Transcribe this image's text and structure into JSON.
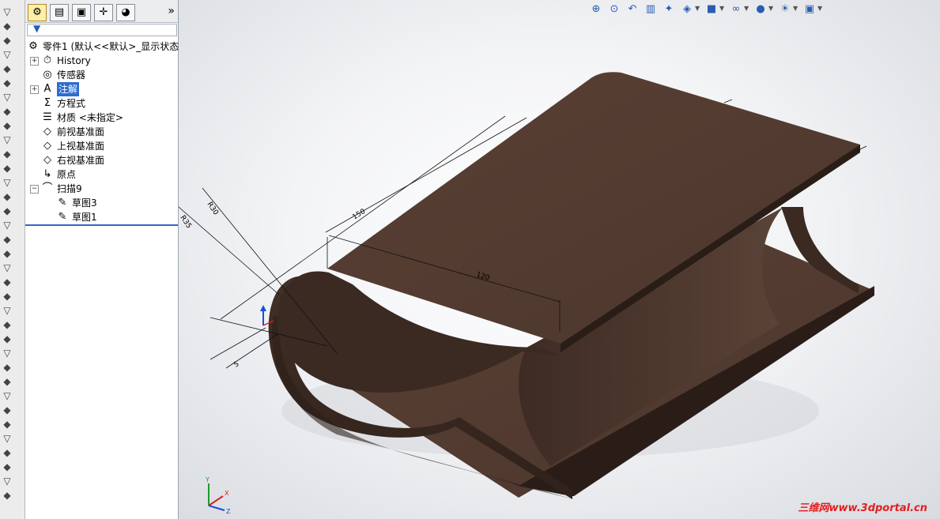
{
  "feature_manager": {
    "tabs": [
      "featuremanager-tab",
      "propertymanager-tab",
      "configurationmanager-tab",
      "dimxpert-tab",
      "display-manager-tab"
    ],
    "more": "»",
    "tree": [
      {
        "label": "零件1  (默认<<默认>_显示状态",
        "icon": "part-icon",
        "level": 0,
        "expander": ""
      },
      {
        "label": "History",
        "icon": "history-icon",
        "level": 1,
        "expander": "+"
      },
      {
        "label": "传感器",
        "icon": "sensor-icon",
        "level": 1,
        "expander": ""
      },
      {
        "label": "注解",
        "icon": "annotation-icon",
        "level": 1,
        "expander": "+",
        "selected": true
      },
      {
        "label": "方程式",
        "icon": "equation-icon",
        "level": 1,
        "expander": ""
      },
      {
        "label": "材质 <未指定>",
        "icon": "material-icon",
        "level": 1,
        "expander": ""
      },
      {
        "label": "前视基准面",
        "icon": "plane-icon",
        "level": 1,
        "expander": ""
      },
      {
        "label": "上视基准面",
        "icon": "plane-icon",
        "level": 1,
        "expander": ""
      },
      {
        "label": "右视基准面",
        "icon": "plane-icon",
        "level": 1,
        "expander": ""
      },
      {
        "label": "原点",
        "icon": "origin-icon",
        "level": 1,
        "expander": ""
      },
      {
        "label": "扫描9",
        "icon": "sweep-icon",
        "level": 1,
        "expander": "−"
      },
      {
        "label": "草图3",
        "icon": "sketch-icon",
        "level": 2,
        "expander": ""
      },
      {
        "label": "草图1",
        "icon": "sketch-icon",
        "level": 2,
        "expander": ""
      }
    ]
  },
  "heads_up_toolbar": [
    "zoom-to-fit-icon",
    "zoom-to-area-icon",
    "previous-view-icon",
    "section-view-icon",
    "dynamic-annotation-icon",
    "view-orientation-icon",
    "display-style-icon",
    "hide-show-items-icon",
    "edit-appearance-icon",
    "apply-scene-icon",
    "view-settings-icon"
  ],
  "dimensions": {
    "d_r30": "R30",
    "d_r35": "R35",
    "d_w": "150",
    "d_len": "120",
    "d_thk": "5"
  },
  "watermark": "三维网www.3dportal.cn",
  "colors": {
    "material": "#4a342a",
    "material_light": "#5c4437",
    "selection": "#2e6cd0"
  }
}
